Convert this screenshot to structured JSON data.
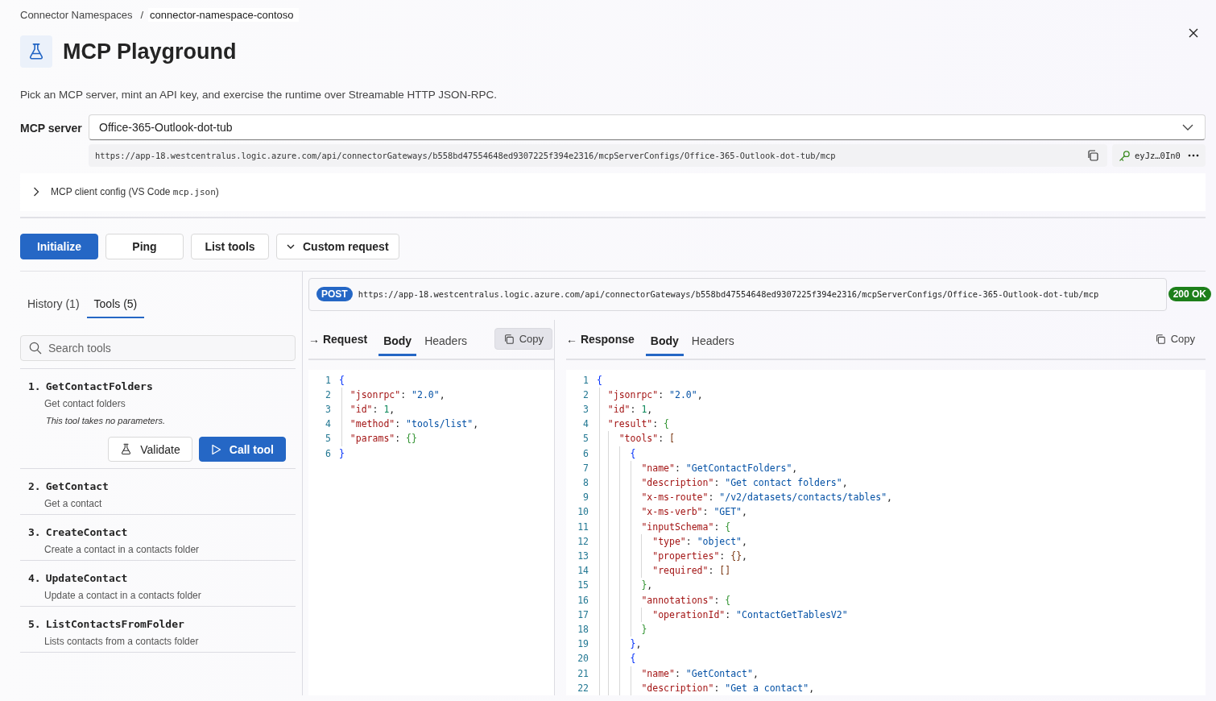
{
  "breadcrumb": [
    {
      "label": "Connector Namespaces",
      "selected": false
    },
    {
      "label": "connector-namespace-contoso",
      "selected": true
    }
  ],
  "breadcrumb_separator": "/",
  "header": {
    "title": "MCP Playground",
    "description": "Pick an MCP server, mint an API key, and exercise the runtime over Streamable HTTP JSON-RPC."
  },
  "server": {
    "label": "MCP server",
    "value": "Office-365-Outlook-dot-tub",
    "endpoint": "https://app-18.westcentralus.logic.azure.com/api/connectorGateways/b558bd47554648ed9307225f394e2316/mcpServerConfigs/Office-365-Outlook-dot-tub/mcp",
    "api_key": "eyJz…0In0"
  },
  "config_toggle": {
    "label": "MCP client config (VS Code ",
    "file": "mcp.json",
    "suffix": ")",
    "expanded": false
  },
  "actions": [
    {
      "label": "Initialize",
      "kind": "primary"
    },
    {
      "label": "Ping",
      "kind": "default"
    },
    {
      "label": "List tools",
      "kind": "default"
    },
    {
      "label": "Custom request",
      "kind": "dropdown"
    }
  ],
  "side_tabs": [
    {
      "label": "History (1)",
      "selected": false
    },
    {
      "label": "Tools (5)",
      "selected": true
    }
  ],
  "search": {
    "placeholder": "Search tools"
  },
  "tools": [
    {
      "number": "1.",
      "name": "GetContactFolders",
      "description": "Get contact folders",
      "expanded": true,
      "note": "This tool takes no parameters.",
      "validate": "Validate",
      "call": "Call tool"
    },
    {
      "number": "2.",
      "name": "GetContact",
      "description": "Get a contact",
      "expanded": false
    },
    {
      "number": "3.",
      "name": "CreateContact",
      "description": "Create a contact in a contacts folder",
      "expanded": false
    },
    {
      "number": "4.",
      "name": "UpdateContact",
      "description": "Update a contact in a contacts folder",
      "expanded": false
    },
    {
      "number": "5.",
      "name": "ListContactsFromFolder",
      "description": "Lists contacts from a contacts folder",
      "expanded": false
    }
  ],
  "request_line": {
    "method": "POST",
    "url": "https://app-18.westcentralus.logic.azure.com/api/connectorGateways/b558bd47554648ed9307225f394e2316/mcpServerConfigs/Office-365-Outlook-dot-tub/mcp",
    "status": "200 OK"
  },
  "panels": [
    {
      "title": "→ Request",
      "tabs": [
        {
          "label": "Body",
          "selected": true
        },
        {
          "label": "Headers",
          "selected": false
        }
      ],
      "copy": "Copy",
      "copy_filled": true,
      "lines": [
        {
          "n": "1",
          "code": "{"
        },
        {
          "n": "2",
          "code": "  \"jsonrpc\": \"2.0\","
        },
        {
          "n": "3",
          "code": "  \"id\": 1,"
        },
        {
          "n": "4",
          "code": "  \"method\": \"tools/list\","
        },
        {
          "n": "5",
          "code": "  \"params\": {}"
        },
        {
          "n": "6",
          "code": "}"
        }
      ]
    },
    {
      "title": "← Response",
      "tabs": [
        {
          "label": "Body",
          "selected": true
        },
        {
          "label": "Headers",
          "selected": false
        }
      ],
      "copy": "Copy",
      "copy_filled": false,
      "lines": [
        {
          "n": "1",
          "code": "{"
        },
        {
          "n": "2",
          "code": "  \"jsonrpc\": \"2.0\","
        },
        {
          "n": "3",
          "code": "  \"id\": 1,"
        },
        {
          "n": "4",
          "code": "  \"result\": {"
        },
        {
          "n": "5",
          "code": "    \"tools\": ["
        },
        {
          "n": "6",
          "code": "      {"
        },
        {
          "n": "7",
          "code": "        \"name\": \"GetContactFolders\","
        },
        {
          "n": "8",
          "code": "        \"description\": \"Get contact folders\","
        },
        {
          "n": "9",
          "code": "        \"x-ms-route\": \"/v2/datasets/contacts/tables\","
        },
        {
          "n": "10",
          "code": "        \"x-ms-verb\": \"GET\","
        },
        {
          "n": "11",
          "code": "        \"inputSchema\": {"
        },
        {
          "n": "12",
          "code": "          \"type\": \"object\","
        },
        {
          "n": "13",
          "code": "          \"properties\": {},"
        },
        {
          "n": "14",
          "code": "          \"required\": []"
        },
        {
          "n": "15",
          "code": "        },"
        },
        {
          "n": "16",
          "code": "        \"annotations\": {"
        },
        {
          "n": "17",
          "code": "          \"operationId\": \"ContactGetTablesV2\""
        },
        {
          "n": "18",
          "code": "        }"
        },
        {
          "n": "19",
          "code": "      },"
        },
        {
          "n": "20",
          "code": "      {"
        },
        {
          "n": "21",
          "code": "        \"name\": \"GetContact\","
        },
        {
          "n": "22",
          "code": "        \"description\": \"Get a contact\","
        }
      ]
    }
  ]
}
